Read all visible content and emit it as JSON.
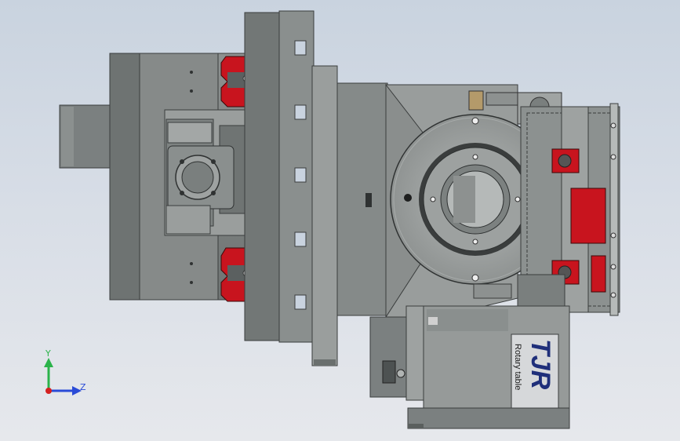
{
  "viewport": {
    "background_top": "#c9d3df",
    "background_bottom": "#e6e8ec"
  },
  "branding": {
    "logo": "TJR",
    "subtitle": "Rotary table",
    "logo_color": "#1f2f7a"
  },
  "triad": {
    "y_label": "Y",
    "z_label": "Z",
    "y_color": "#2bb34a",
    "z_color": "#2a4bd7",
    "x_color": "#d42020"
  },
  "colors": {
    "metal_dark": "#5f6463",
    "metal_mid": "#7d8281",
    "metal_light": "#a9adac",
    "accent_red": "#c8141e"
  }
}
